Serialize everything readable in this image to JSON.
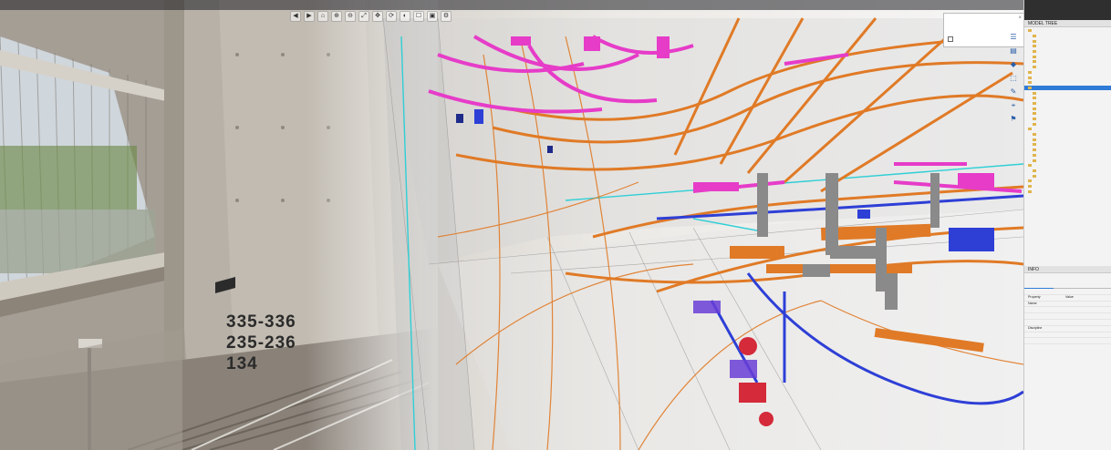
{
  "wall_label": [
    "335-336",
    "235-236",
    "134"
  ],
  "toolbar": {
    "items": [
      "",
      "",
      "",
      "",
      ""
    ],
    "view_buttons": [
      "◀",
      "▶",
      "⌂",
      "⊕",
      "⊖",
      "⤢",
      "✥",
      "⟳",
      "◐",
      "☐",
      "▣",
      "⚙"
    ],
    "right_text": ""
  },
  "tip": {
    "text": "",
    "checkbox_label": ""
  },
  "side_icons": [
    "☰",
    "▤",
    "◆",
    "⬚",
    "✎",
    "⌖",
    "⚑"
  ],
  "model_tree": {
    "header": "MODEL TREE",
    "rows": [
      {
        "label": "",
        "level": 1,
        "selected": false
      },
      {
        "label": "",
        "level": 2,
        "selected": false
      },
      {
        "label": "",
        "level": 2,
        "selected": false
      },
      {
        "label": "",
        "level": 2,
        "selected": false
      },
      {
        "label": "",
        "level": 2,
        "selected": false
      },
      {
        "label": "",
        "level": 2,
        "selected": false
      },
      {
        "label": "",
        "level": 2,
        "selected": false
      },
      {
        "label": "",
        "level": 2,
        "selected": false
      },
      {
        "label": "",
        "level": 1,
        "selected": false
      },
      {
        "label": "",
        "level": 1,
        "selected": false
      },
      {
        "label": "",
        "level": 1,
        "selected": false
      },
      {
        "label": "",
        "level": 1,
        "selected": true
      },
      {
        "label": "",
        "level": 2,
        "selected": false
      },
      {
        "label": "",
        "level": 2,
        "selected": false
      },
      {
        "label": "",
        "level": 2,
        "selected": false
      },
      {
        "label": "",
        "level": 2,
        "selected": false
      },
      {
        "label": "",
        "level": 2,
        "selected": false
      },
      {
        "label": "",
        "level": 2,
        "selected": false
      },
      {
        "label": "",
        "level": 2,
        "selected": false
      },
      {
        "label": "",
        "level": 1,
        "selected": false
      },
      {
        "label": "",
        "level": 2,
        "selected": false
      },
      {
        "label": "",
        "level": 2,
        "selected": false
      },
      {
        "label": "",
        "level": 2,
        "selected": false
      },
      {
        "label": "",
        "level": 2,
        "selected": false
      },
      {
        "label": "",
        "level": 2,
        "selected": false
      },
      {
        "label": "",
        "level": 2,
        "selected": false
      },
      {
        "label": "",
        "level": 1,
        "selected": false
      },
      {
        "label": "",
        "level": 2,
        "selected": false
      },
      {
        "label": "",
        "level": 2,
        "selected": false
      },
      {
        "label": "",
        "level": 1,
        "selected": false
      },
      {
        "label": "",
        "level": 1,
        "selected": false
      },
      {
        "label": "",
        "level": 1,
        "selected": false
      }
    ]
  },
  "info": {
    "header": "INFO",
    "title": "",
    "tabs": [
      "",
      "",
      ""
    ],
    "rows": [
      {
        "k": "",
        "v": ""
      },
      {
        "k": "Property",
        "v": "Value"
      },
      {
        "k": "Name",
        "v": ""
      },
      {
        "k": "",
        "v": ""
      },
      {
        "k": "",
        "v": ""
      },
      {
        "k": "",
        "v": ""
      },
      {
        "k": "Discipline",
        "v": ""
      },
      {
        "k": "",
        "v": ""
      },
      {
        "k": "",
        "v": ""
      }
    ]
  },
  "colors": {
    "magenta": "#e63cc8",
    "orange": "#e07a26",
    "blue": "#2e3fd6",
    "cyan": "#2ecfd6",
    "red": "#d42a3a",
    "gray": "#8a8a8a",
    "selected": "#2f7bd6"
  }
}
